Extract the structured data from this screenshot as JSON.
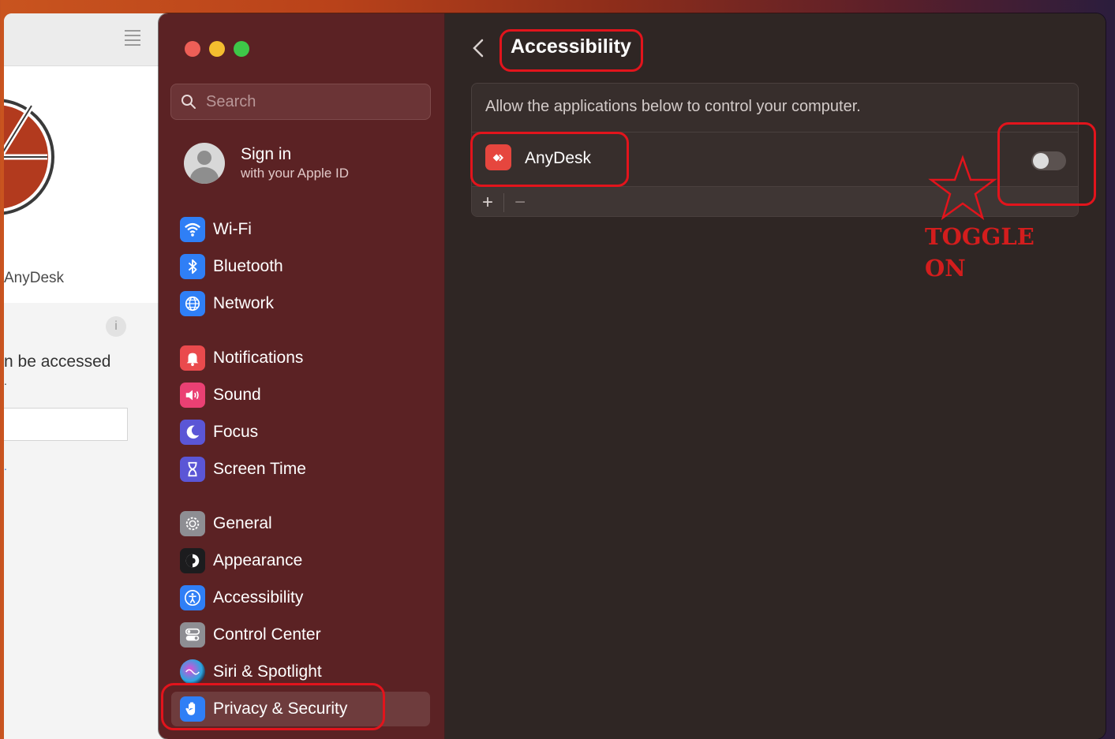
{
  "background_window": {
    "brand_text": "AnyDesk",
    "info_icon": "i",
    "access_line1": "n be accessed",
    "access_line2": ".",
    "link_text": "."
  },
  "sidebar": {
    "search_placeholder": "Search",
    "signin_title": "Sign in",
    "signin_subtitle": "with your Apple ID",
    "items": [
      {
        "label": "Wi-Fi",
        "icon": "wifi-icon",
        "color": "#2f7ff6"
      },
      {
        "label": "Bluetooth",
        "icon": "bluetooth-icon",
        "color": "#2f7ff6"
      },
      {
        "label": "Network",
        "icon": "globe-icon",
        "color": "#2f7ff6"
      },
      {
        "label": "Notifications",
        "icon": "bell-icon",
        "color": "#ea4a4d"
      },
      {
        "label": "Sound",
        "icon": "speaker-icon",
        "color": "#ea4073"
      },
      {
        "label": "Focus",
        "icon": "moon-icon",
        "color": "#5b56d6"
      },
      {
        "label": "Screen Time",
        "icon": "hourglass-icon",
        "color": "#5b56d6"
      },
      {
        "label": "General",
        "icon": "gear-icon",
        "color": "#8e8e93"
      },
      {
        "label": "Appearance",
        "icon": "appearance-icon",
        "color": "#1c1c1e"
      },
      {
        "label": "Accessibility",
        "icon": "accessibility-icon",
        "color": "#2f7ff6"
      },
      {
        "label": "Control Center",
        "icon": "control-center-icon",
        "color": "#8e8e93"
      },
      {
        "label": "Siri & Spotlight",
        "icon": "siri-icon",
        "color": "#3a2b55"
      },
      {
        "label": "Privacy & Security",
        "icon": "hand-icon",
        "color": "#2f7ff6"
      }
    ],
    "selected": "Privacy & Security"
  },
  "content": {
    "title": "Accessibility",
    "description": "Allow the applications below to control your computer.",
    "apps": [
      {
        "name": "AnyDesk",
        "enabled": false
      }
    ],
    "add_label": "+",
    "remove_label": "−"
  },
  "annotation": {
    "text": "TOGGLE\nON",
    "color": "#e2141c"
  }
}
